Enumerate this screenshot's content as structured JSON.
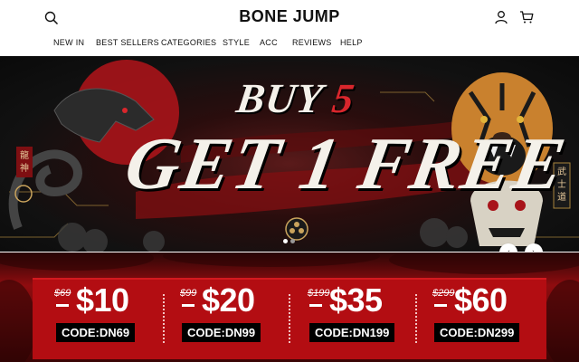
{
  "header": {
    "logo": "BONE JUMP",
    "icons": {
      "search": "search-icon",
      "account": "user-icon",
      "cart": "cart-icon"
    },
    "nav": [
      "NEW IN",
      "BEST SELLERS",
      "CATEGORIES",
      "STYLE",
      "ACC",
      "REVIEWS",
      "HELP"
    ]
  },
  "hero": {
    "line1_word": "BUY",
    "line1_num": "5",
    "line2": "GET 1 FREE",
    "kanji_left": "龍神",
    "kanji_right": "武士道",
    "carousel": {
      "slides": 2,
      "active": 1,
      "prev_icon": "chevron-left-icon",
      "next_icon": "chevron-right-icon",
      "prev_glyph": "‹",
      "next_glyph": "›"
    }
  },
  "deals": [
    {
      "old": "$69",
      "price": "$10",
      "code": "CODE:DN69"
    },
    {
      "old": "$99",
      "price": "$20",
      "code": "CODE:DN99"
    },
    {
      "old": "$199",
      "price": "$35",
      "code": "CODE:DN199"
    },
    {
      "old": "$299",
      "price": "$60",
      "code": "CODE:DN299"
    }
  ],
  "colors": {
    "accent_red": "#d9262c",
    "panel_red": "#b30d12",
    "code_bg": "#000000",
    "text_light": "#f4f1ea"
  }
}
